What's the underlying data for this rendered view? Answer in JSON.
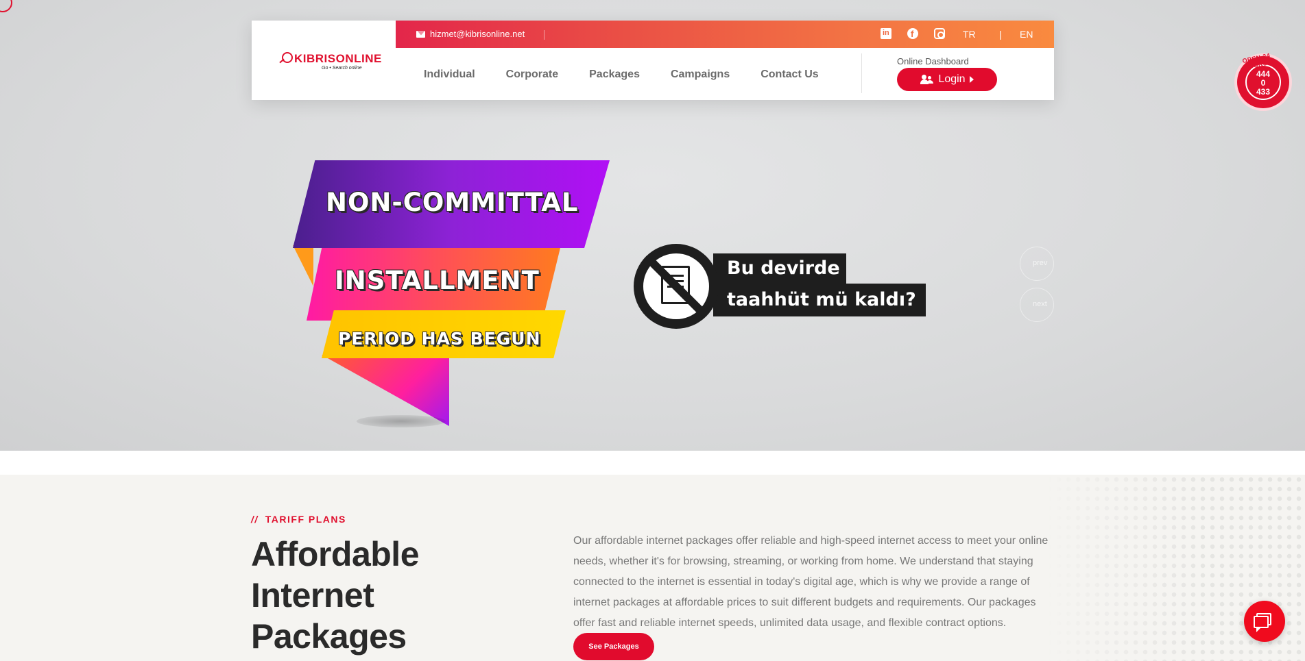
{
  "header": {
    "logo": {
      "brand": "KIBRISONLINE",
      "tagline": "Go • Search online"
    },
    "topbar": {
      "email": "hizmet@kibrisonline.net",
      "social": [
        "linkedin-icon",
        "facebook-icon",
        "instagram-icon"
      ],
      "lang_tr": "TR",
      "lang_sep": "|",
      "lang_en": "EN"
    },
    "nav": [
      "Individual",
      "Corporate",
      "Packages",
      "Campaigns",
      "Contact Us"
    ],
    "dashboard_label": "Online Dashboard",
    "login_label": "Login"
  },
  "badge24": {
    "arc_text": "OPEN 24 HOURS",
    "number_lines": [
      "444",
      "0",
      "433"
    ]
  },
  "hero": {
    "line1": "NON-COMMITTAL",
    "line2": "INSTALLMENT",
    "line3": "PERIOD HAS BEGUN",
    "tr_line1": "Bu devirde",
    "tr_line2": "taahhüt mü kaldı?",
    "prev_label": "prev",
    "next_label": "next"
  },
  "tariff": {
    "eyebrow_slashes": "//",
    "eyebrow": "TARIFF PLANS",
    "title": "Affordable Internet Packages",
    "description": "Our affordable internet packages offer reliable and high-speed internet access to meet your online needs, whether it's for browsing, streaming, or working from home. We understand that staying connected to the internet is essential in today's digital age, which is why we provide a range of internet packages at affordable prices to suit different budgets and requirements. Our packages offer fast and reliable internet speeds, unlimited data usage, and flexible contract options.",
    "button": "See Packages"
  },
  "colors": {
    "brand_red": "#e10b2d",
    "gradient_start": "#e3264a",
    "gradient_end": "#f98a3f"
  }
}
